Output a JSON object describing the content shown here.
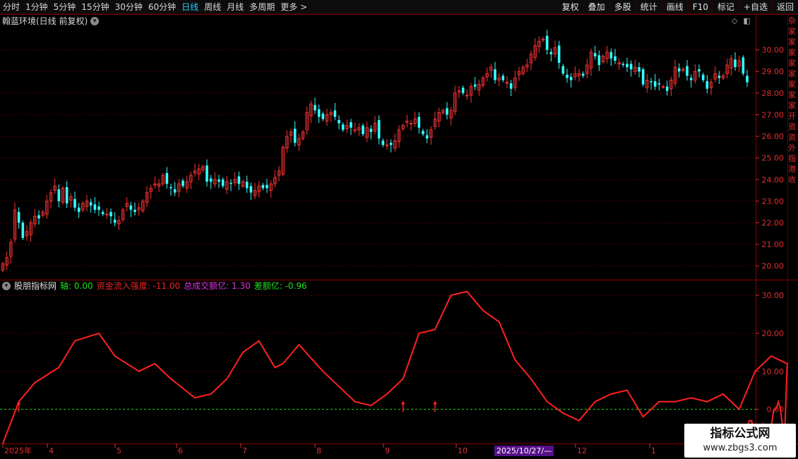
{
  "toolbar": {
    "tabs": [
      "分时",
      "1分钟",
      "5分钟",
      "15分钟",
      "30分钟",
      "60分钟",
      "日线",
      "周线",
      "月线",
      "多周期",
      "更多 >"
    ],
    "active_tab": 6,
    "right_buttons": [
      "复权",
      "叠加",
      "多股",
      "统计",
      "画线",
      "F10",
      "标记",
      "+自选",
      "返回"
    ]
  },
  "main_panel": {
    "title": "翰蓝环境(日线 前复权)",
    "y_ticks": [
      "30.00",
      "29.00",
      "28.00",
      "27.00",
      "26.00",
      "25.00",
      "24.00",
      "23.00",
      "22.00",
      "21.00",
      "20.00"
    ],
    "right_edge_text": [
      "杂",
      "家",
      "家",
      "家",
      "家",
      "家",
      "家",
      "家",
      "家",
      "开",
      "资",
      "资",
      "外",
      "指",
      "港",
      "收"
    ]
  },
  "indicator_panel": {
    "name": "股朋指标网",
    "legend": [
      {
        "label": "轴:",
        "value": "0.00",
        "color": "#22dd22"
      },
      {
        "label": "资金流入强度:",
        "value": "-11.00",
        "color": "#ee2222"
      },
      {
        "label": "总成交额亿:",
        "value": "1.30",
        "color": "#dd33dd"
      },
      {
        "label": "差额亿:",
        "value": "-0.96",
        "color": "#22dd22"
      }
    ],
    "y_ticks": [
      "30.00",
      "20.00",
      "10.00",
      "0.00"
    ],
    "right_edge_text": [
      "白",
      "交",
      "1",
      "1",
      "1",
      "1",
      "1",
      "1",
      "1",
      "1",
      "1",
      "1",
      "1",
      "1"
    ]
  },
  "x_axis": {
    "labels": [
      "2025年",
      "4",
      "5",
      "6",
      "7",
      "8",
      "9",
      "10",
      "12",
      "1"
    ],
    "highlight_date": "2025/10/27/—"
  },
  "watermark": {
    "line1": "指标公式网",
    "line2": "www.zbgs3.com"
  },
  "colors": {
    "up": "#ff3333",
    "down": "#33ffff",
    "grid": "#5a0000",
    "zero": "#22dd22",
    "line": "#ff2020",
    "bg": "#000000"
  },
  "chart_data": [
    {
      "type": "candlestick",
      "title": "翰蓝环境(日线 前复权)",
      "ylim": [
        19.5,
        31.0
      ],
      "close": [
        20.1,
        20.4,
        21.1,
        22.6,
        22.0,
        21.3,
        21.6,
        22.0,
        22.3,
        22.2,
        22.5,
        23.0,
        23.4,
        23.7,
        23.0,
        23.6,
        22.9,
        23.2,
        22.7,
        22.5,
        22.9,
        23.0,
        22.8,
        22.6,
        22.6,
        22.4,
        22.4,
        22.3,
        22.0,
        22.1,
        22.6,
        22.9,
        22.6,
        22.5,
        22.7,
        23.0,
        23.4,
        23.6,
        23.8,
        23.8,
        24.2,
        23.8,
        23.6,
        23.4,
        23.8,
        23.7,
        23.9,
        24.2,
        24.4,
        24.5,
        24.6,
        23.9,
        23.9,
        24.0,
        23.9,
        23.7,
        23.9,
        23.8,
        24.0,
        23.8,
        23.9,
        23.6,
        23.4,
        23.5,
        23.7,
        23.6,
        23.6,
        23.8,
        24.1,
        24.4,
        25.5,
        26.0,
        26.2,
        25.7,
        25.9,
        26.2,
        27.1,
        27.5,
        27.2,
        26.9,
        26.8,
        27.0,
        27.1,
        26.9,
        26.6,
        26.3,
        26.5,
        26.4,
        26.3,
        26.4,
        26.1,
        26.4,
        26.2,
        26.6,
        25.9,
        25.6,
        25.6,
        25.6,
        25.8,
        26.3,
        26.5,
        26.7,
        26.6,
        26.8,
        26.4,
        26.1,
        25.9,
        26.3,
        26.8,
        27.1,
        27.2,
        27.0,
        27.2,
        28.0,
        28.1,
        28.0,
        27.9,
        28.3,
        28.3,
        28.4,
        28.7,
        28.9,
        29.2,
        28.6,
        28.7,
        28.6,
        28.5,
        28.2,
        28.7,
        29.0,
        29.2,
        29.3,
        29.8,
        30.2,
        30.4,
        30.5,
        30.0,
        29.8,
        30.1,
        29.4,
        28.9,
        28.7,
        28.6,
        28.9,
        28.9,
        28.8,
        29.3,
        29.9,
        29.7,
        29.3,
        29.7,
        29.9,
        29.6,
        29.5,
        29.4,
        29.3,
        29.2,
        29.1,
        29.2,
        29.0,
        28.4,
        28.6,
        28.5,
        28.3,
        28.4,
        28.3,
        28.1,
        28.6,
        29.2,
        29.0,
        29.1,
        28.8,
        28.6,
        29.0,
        29.0,
        28.6,
        28.2,
        28.5,
        28.9,
        28.7,
        28.8,
        29.3,
        29.6,
        29.2,
        29.5,
        28.9,
        28.5
      ]
    },
    {
      "type": "line",
      "ylim": [
        -9,
        33
      ],
      "x": [
        0,
        4,
        8,
        14,
        18,
        24,
        28,
        34,
        38,
        42,
        48,
        52,
        56,
        60,
        64,
        68,
        70,
        74,
        80,
        84,
        88,
        92,
        96,
        100,
        104,
        108,
        112,
        116,
        120,
        124,
        128,
        132,
        136,
        140,
        144,
        148,
        152,
        156,
        160,
        164,
        168,
        172,
        176,
        180,
        184,
        188,
        192,
        196
      ],
      "series": [
        {
          "name": "资金流入强度",
          "values": [
            -9,
            2,
            7,
            11,
            18,
            20,
            14,
            10,
            12,
            8,
            3,
            4,
            8,
            15,
            18,
            11,
            12,
            17,
            10,
            6,
            2,
            1,
            4,
            8,
            20,
            21,
            30,
            31,
            26,
            23,
            13,
            8,
            2,
            -1,
            -3,
            2,
            4,
            5,
            -2,
            2,
            2,
            3,
            2,
            4,
            0,
            10,
            14,
            12
          ]
        }
      ]
    }
  ]
}
